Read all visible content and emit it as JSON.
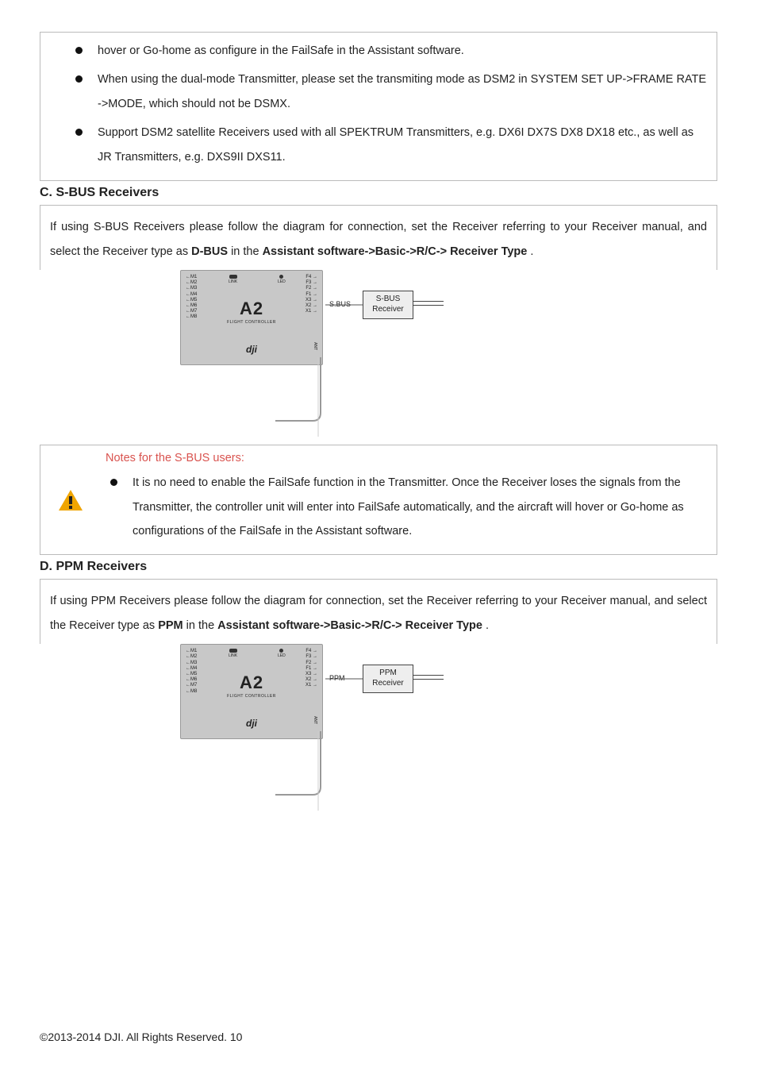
{
  "top_box": {
    "bullets": [
      "hover or Go-home as configure in the FailSafe in the Assistant software.",
      "When using the dual-mode Transmitter, please set the transmiting mode as DSM2 in SYSTEM SET UP->FRAME RATE ->MODE, which should not be DSMX.",
      "Support DSM2 satellite Receivers used with all SPEKTRUM Transmitters, e.g. DX6I DX7S DX8 DX18 etc., as well as JR Transmitters, e.g. DXS9II DXS11."
    ]
  },
  "section_c": {
    "heading": "C.    S-BUS Receivers",
    "lead_plain": "If using S-BUS Receivers please follow the diagram for connection, set the Receiver referring to your Receiver manual, and select the Receiver type as ",
    "lead_b1": "D-BUS",
    "lead_mid": " in the ",
    "lead_b2": "Assistant software->Basic->R/C-> Receiver Type",
    "lead_end": ".",
    "port_label": "S.BUS",
    "receiver_line1": "S-BUS",
    "receiver_line2": "Receiver"
  },
  "sbus_notes": {
    "title": "Notes for the S-BUS users:",
    "bullet": "It is no need to enable the FailSafe function in the Transmitter. Once the Receiver loses the signals from the Transmitter, the controller unit will enter into FailSafe automatically, and the aircraft will hover or Go-home as configurations of the FailSafe in the Assistant software."
  },
  "section_d": {
    "heading": "D.    PPM Receivers",
    "lead_plain": "If using PPM Receivers please follow the diagram for connection, set the Receiver referring to your Receiver manual, and select the Receiver type as ",
    "lead_b1": "PPM",
    "lead_mid": " in the ",
    "lead_b2": "Assistant software->Basic->R/C-> Receiver Type",
    "lead_end": ".",
    "port_label": "PPM",
    "receiver_line1": "PPM",
    "receiver_line2": "Receiver"
  },
  "controller": {
    "name": "A2",
    "sub": "FLIGHT CONTROLLER",
    "brand": "dji",
    "link": "LINK",
    "led": "LED",
    "m_labels": [
      "←M1",
      "←M2",
      "←M3",
      "←M4",
      "←M5",
      "←M6",
      "←M7",
      "←M8"
    ],
    "f_labels": [
      "F4 →",
      "F3 →",
      "F2 →",
      "F1 →",
      "X3 →",
      "X2 →",
      "X1 →"
    ],
    "ant": "ANT"
  },
  "footer": {
    "text": "©2013-2014 DJI. All Rights Reserved.   10"
  }
}
